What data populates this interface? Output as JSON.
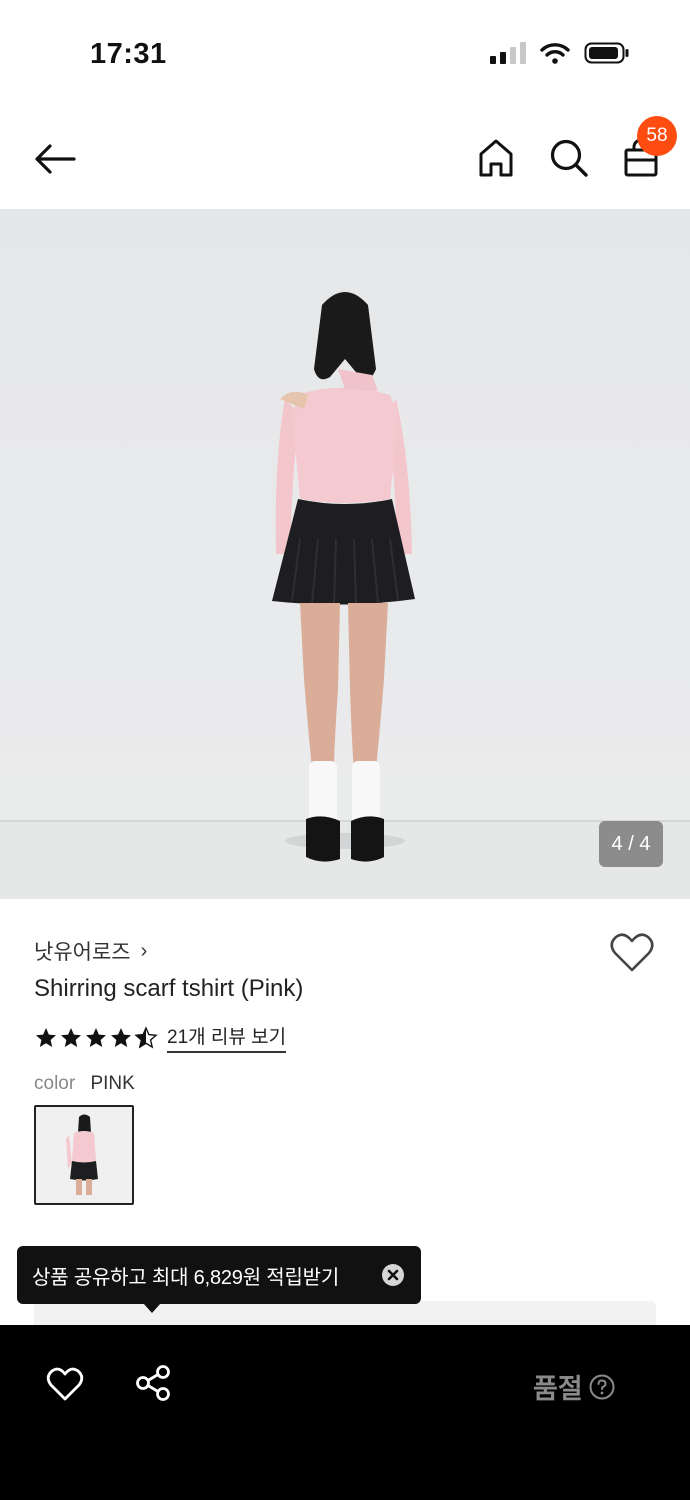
{
  "status_bar": {
    "time": "17:31"
  },
  "header": {
    "cart_count": "58"
  },
  "gallery": {
    "counter": "4 / 4"
  },
  "product": {
    "brand": "낫유어로즈",
    "brand_chevron": "›",
    "name": "Shirring scarf tshirt (Pink)",
    "rating_stars": 4.5,
    "review_link": "21개 리뷰 보기",
    "color_label": "color",
    "color_value": "PINK"
  },
  "share_tooltip": {
    "text": "상품 공유하고 최대 6,829원 적립받기"
  },
  "bottom_bar": {
    "status": "품절"
  },
  "colors": {
    "badge": "#ff4d12",
    "bottom_bar": "#000000",
    "tooltip": "#111111",
    "soldout": "#8a8a8a"
  },
  "icons": [
    "back-arrow-icon",
    "home-icon",
    "search-icon",
    "shopping-bag-icon",
    "heart-icon",
    "star-icon",
    "close-icon",
    "share-icon",
    "help-icon"
  ]
}
